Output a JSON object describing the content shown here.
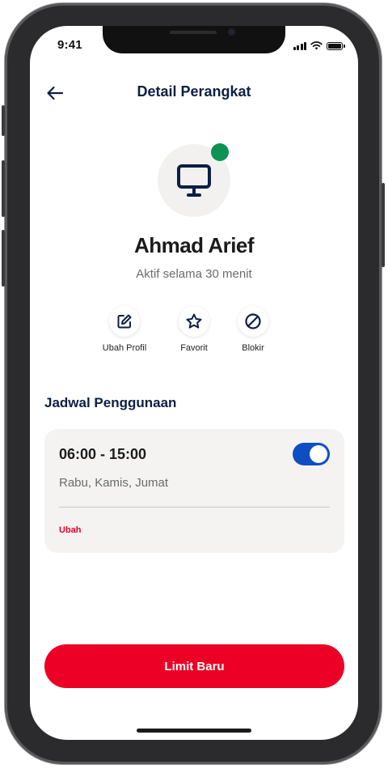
{
  "status_bar": {
    "time": "9:41"
  },
  "header": {
    "title": "Detail Perangkat",
    "back_icon": "arrow-left-icon"
  },
  "device": {
    "icon": "monitor-icon",
    "status_color": "#0c9255",
    "name": "Ahmad Arief",
    "status_text": "Aktif selama 30 menit"
  },
  "actions": [
    {
      "label": "Ubah Profil",
      "icon": "edit-icon"
    },
    {
      "label": "Favorit",
      "icon": "star-icon"
    },
    {
      "label": "Blokir",
      "icon": "block-icon"
    }
  ],
  "schedule": {
    "section_title": "Jadwal Penggunaan",
    "time_range": "06:00 - 15:00",
    "days": "Rabu, Kamis, Jumat",
    "enabled": true,
    "edit_label": "Ubah"
  },
  "primary_button": {
    "label": "Limit Baru"
  },
  "colors": {
    "primary_red": "#ec0025",
    "navy": "#0c1f44",
    "toggle_blue": "#0d4fc2"
  }
}
